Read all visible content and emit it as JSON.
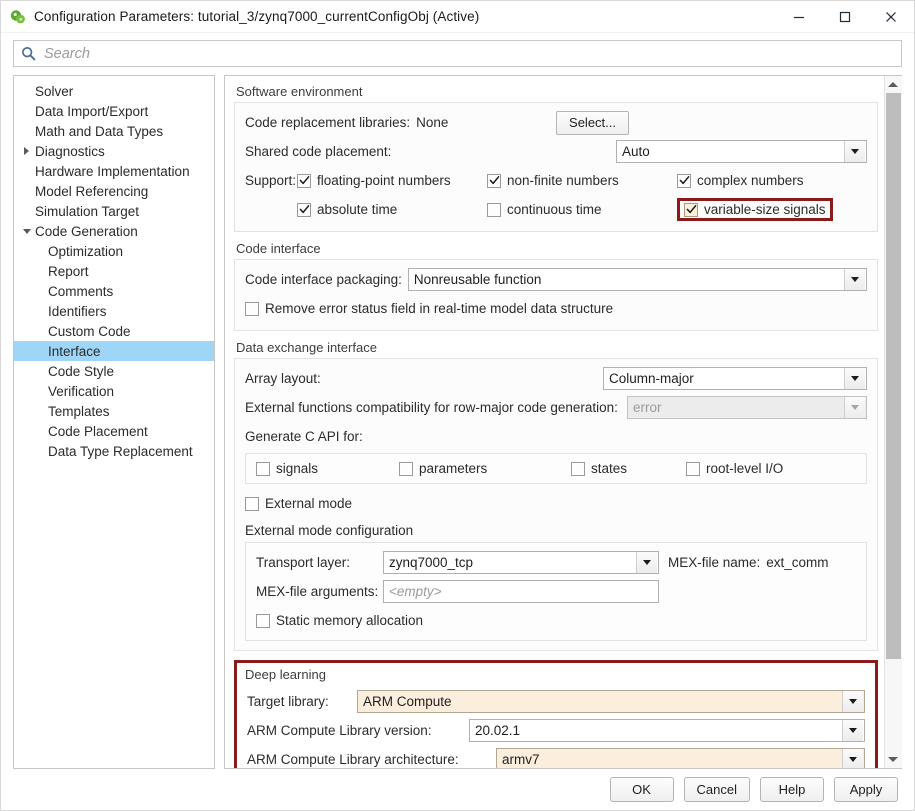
{
  "window": {
    "title": "Configuration Parameters: tutorial_3/zynq7000_currentConfigObj (Active)",
    "icon": "simulink-icon",
    "minimize": "minimize-icon",
    "maximize": "maximize-icon",
    "close": "close-icon"
  },
  "search": {
    "placeholder": "Search",
    "value": "",
    "icon": "search-icon"
  },
  "sidebar": {
    "items": [
      {
        "label": "Solver",
        "indent": 1,
        "arrow": "none",
        "selected": false
      },
      {
        "label": "Data Import/Export",
        "indent": 1,
        "arrow": "none",
        "selected": false
      },
      {
        "label": "Math and Data Types",
        "indent": 1,
        "arrow": "none",
        "selected": false
      },
      {
        "label": "Diagnostics",
        "indent": 0,
        "arrow": "collapsed",
        "selected": false
      },
      {
        "label": "Hardware Implementation",
        "indent": 1,
        "arrow": "none",
        "selected": false
      },
      {
        "label": "Model Referencing",
        "indent": 1,
        "arrow": "none",
        "selected": false
      },
      {
        "label": "Simulation Target",
        "indent": 1,
        "arrow": "none",
        "selected": false
      },
      {
        "label": "Code Generation",
        "indent": 0,
        "arrow": "expanded",
        "selected": false
      },
      {
        "label": "Optimization",
        "indent": 2,
        "arrow": "none",
        "selected": false
      },
      {
        "label": "Report",
        "indent": 2,
        "arrow": "none",
        "selected": false
      },
      {
        "label": "Comments",
        "indent": 2,
        "arrow": "none",
        "selected": false
      },
      {
        "label": "Identifiers",
        "indent": 2,
        "arrow": "none",
        "selected": false
      },
      {
        "label": "Custom Code",
        "indent": 2,
        "arrow": "none",
        "selected": false
      },
      {
        "label": "Interface",
        "indent": 2,
        "arrow": "none",
        "selected": true
      },
      {
        "label": "Code Style",
        "indent": 2,
        "arrow": "none",
        "selected": false
      },
      {
        "label": "Verification",
        "indent": 2,
        "arrow": "none",
        "selected": false
      },
      {
        "label": "Templates",
        "indent": 2,
        "arrow": "none",
        "selected": false
      },
      {
        "label": "Code Placement",
        "indent": 2,
        "arrow": "none",
        "selected": false
      },
      {
        "label": "Data Type Replacement",
        "indent": 2,
        "arrow": "none",
        "selected": false
      }
    ]
  },
  "software_environment": {
    "title": "Software environment",
    "code_replacement_libraries_label": "Code replacement libraries:",
    "code_replacement_libraries_value": "None",
    "select_button": "Select...",
    "shared_code_placement_label": "Shared code placement:",
    "shared_code_placement_value": "Auto",
    "support_label": "Support:",
    "support_checkboxes": [
      {
        "label": "floating-point numbers",
        "checked": true,
        "highlighted": false
      },
      {
        "label": "non-finite numbers",
        "checked": true,
        "highlighted": false
      },
      {
        "label": "complex numbers",
        "checked": true,
        "highlighted": false
      },
      {
        "label": "absolute time",
        "checked": true,
        "highlighted": false
      },
      {
        "label": "continuous time",
        "checked": false,
        "highlighted": false
      },
      {
        "label": "variable-size signals",
        "checked": true,
        "highlighted": true
      }
    ]
  },
  "code_interface": {
    "title": "Code interface",
    "packaging_label": "Code interface packaging:",
    "packaging_value": "Nonreusable function",
    "remove_error_status_label": "Remove error status field in real-time model data structure",
    "remove_error_status_checked": false
  },
  "data_exchange": {
    "title": "Data exchange interface",
    "array_layout_label": "Array layout:",
    "array_layout_value": "Column-major",
    "external_functions_label": "External functions compatibility for row-major code generation:",
    "external_functions_value": "error",
    "external_functions_disabled": true,
    "generate_c_api_label": "Generate C API for:",
    "c_api_checkboxes": [
      {
        "label": "signals",
        "checked": false
      },
      {
        "label": "parameters",
        "checked": false
      },
      {
        "label": "states",
        "checked": false
      },
      {
        "label": "root-level I/O",
        "checked": false
      }
    ],
    "external_mode_label": "External mode",
    "external_mode_checked": false,
    "external_mode_config_label": "External mode configuration",
    "transport_layer_label": "Transport layer:",
    "transport_layer_value": "zynq7000_tcp",
    "mex_file_name_label": "MEX-file name:",
    "mex_file_name_value": "ext_comm",
    "mex_file_args_label": "MEX-file arguments:",
    "mex_file_args_placeholder": "<empty>",
    "mex_file_args_value": "",
    "static_memory_label": "Static memory allocation",
    "static_memory_checked": false
  },
  "deep_learning": {
    "title": "Deep learning",
    "highlighted": true,
    "target_library_label": "Target library:",
    "target_library_value": "ARM Compute",
    "arm_version_label": "ARM Compute Library version:",
    "arm_version_value": "20.02.1",
    "arm_arch_label": "ARM Compute Library architecture:",
    "arm_arch_value": "armv7"
  },
  "footer": {
    "ok": "OK",
    "cancel": "Cancel",
    "help": "Help",
    "apply": "Apply"
  },
  "colors": {
    "selection": "#9fd6f7",
    "highlight_ring": "#8b1a1a",
    "highlight_field": "#fbeedd"
  }
}
